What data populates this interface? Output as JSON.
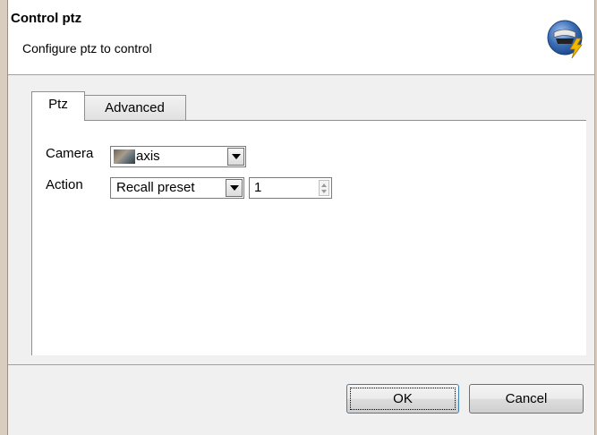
{
  "header": {
    "title": "Control ptz",
    "subtitle": "Configure ptz to control",
    "icon": "camera-lightning-icon"
  },
  "tabs": [
    {
      "label": "Ptz",
      "active": true
    },
    {
      "label": "Advanced",
      "active": false
    }
  ],
  "form": {
    "camera_label": "Camera",
    "camera_value": "axis",
    "action_label": "Action",
    "action_value": "Recall preset",
    "preset_value": "1"
  },
  "footer": {
    "ok_label": "OK",
    "cancel_label": "Cancel"
  },
  "colors": {
    "dialog_bg": "#f0f0f0",
    "header_bg": "#ffffff",
    "icon_blue": "#3a6db5",
    "icon_bolt": "#f5b800"
  }
}
